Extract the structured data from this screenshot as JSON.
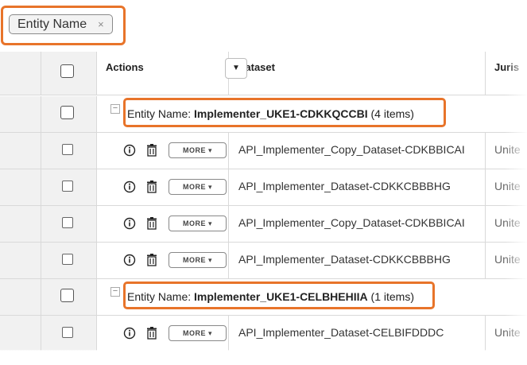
{
  "group_by": {
    "chip_label": "Entity Name",
    "chip_close": "×"
  },
  "columns": {
    "actions": "Actions",
    "dataset": "Dataset",
    "jurisdiction": "Juris",
    "sort_menu_icon": "▼"
  },
  "highlight_color": "#e8742a",
  "row_icons": [
    "info-icon",
    "trash-icon",
    "checkbox-icon"
  ],
  "more_label": "MORE",
  "groups": [
    {
      "prefix": "Entity Name: ",
      "name": "Implementer_UKE1-CDKKQCCBI",
      "count": " (4 items)",
      "rows": [
        {
          "dataset": "API_Implementer_Copy_Dataset-CDKBBICAI",
          "jurisdiction": "Unite"
        },
        {
          "dataset": "API_Implementer_Dataset-CDKKCBBBHG",
          "jurisdiction": "Unite"
        },
        {
          "dataset": "API_Implementer_Copy_Dataset-CDKBBICAI",
          "jurisdiction": "Unite"
        },
        {
          "dataset": "API_Implementer_Dataset-CDKKCBBBHG",
          "jurisdiction": "Unite"
        }
      ]
    },
    {
      "prefix": "Entity Name: ",
      "name": "Implementer_UKE1-CELBHEHIIA",
      "count": " (1 items)",
      "rows": [
        {
          "dataset": "API_Implementer_Dataset-CELBIFDDDC",
          "jurisdiction": "Unite"
        }
      ]
    }
  ]
}
